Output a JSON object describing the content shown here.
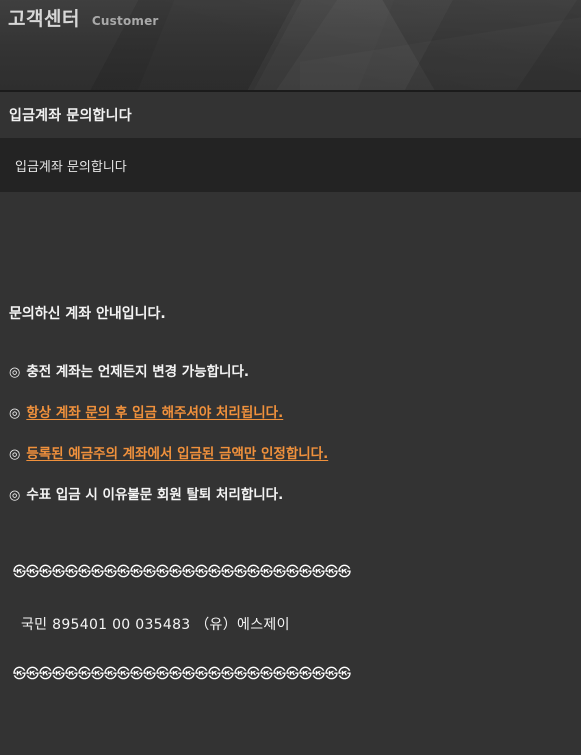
{
  "header": {
    "brand_ko": "고객센터",
    "brand_en": "Customer"
  },
  "title_bar": {
    "title": "입금계좌 문의합니다"
  },
  "subtitle_bar": {
    "subject": "입금계좌 문의합니다"
  },
  "body": {
    "lead": "문의하신 계좌 안내입니다.",
    "notices": [
      {
        "mark": "◎",
        "text": "충전 계좌는 언제든지 변경 가능합니다.",
        "highlight": false
      },
      {
        "mark": "◎",
        "text": "항상 계좌 문의 후 입금 해주셔야 처리됩니다.",
        "highlight": true
      },
      {
        "mark": "◎",
        "text": "등록된 예금주의 계좌에서 입금된 금액만 인정합니다.",
        "highlight": true
      },
      {
        "mark": "◎",
        "text": "수표 입금 시 이유불문 회원 탈퇴 처리합니다.",
        "highlight": false
      }
    ],
    "separator_top": "㉿㉿㉿㉿㉿㉿㉿㉿㉿㉿㉿㉿㉿㉿㉿㉿㉿㉿㉿㉿㉿㉿㉿㉿㉿㉿",
    "account_line": "국민  895401 00 035483 （유）에스제이",
    "separator_bottom": "㉿㉿㉿㉿㉿㉿㉿㉿㉿㉿㉿㉿㉿㉿㉿㉿㉿㉿㉿㉿㉿㉿㉿㉿㉿㉿"
  },
  "colors": {
    "page_bg": "#333333",
    "subtitle_bg": "#232323",
    "header_bg": "#3a3a3a",
    "accent_orange": "#f0913c",
    "text_primary": "#f4f4f4",
    "text_muted": "#a9a9a9"
  }
}
